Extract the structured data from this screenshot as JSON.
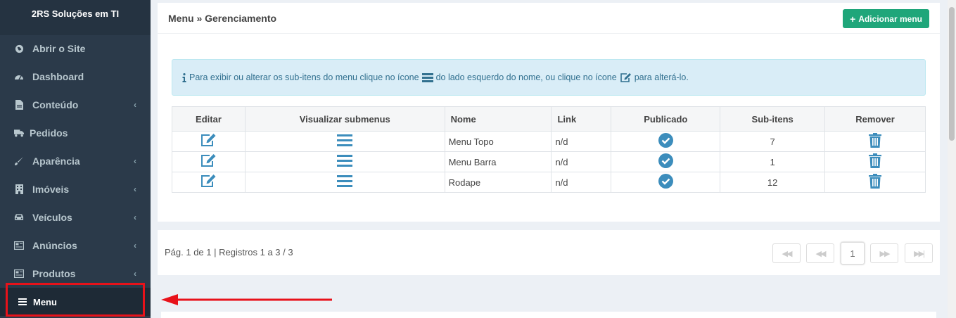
{
  "app": {
    "title": "2RS Soluções em TI"
  },
  "sidebar": {
    "items": [
      {
        "label": "Abrir o Site",
        "icon": "globe-icon",
        "chevron": ""
      },
      {
        "label": "Dashboard",
        "icon": "dashboard-icon",
        "chevron": ""
      },
      {
        "label": "Conteúdo",
        "icon": "file-icon",
        "chevron": "‹"
      },
      {
        "label": "Pedidos",
        "icon": "truck-icon",
        "chevron": ""
      },
      {
        "label": "Aparência",
        "icon": "brush-icon",
        "chevron": "‹"
      },
      {
        "label": "Imóveis",
        "icon": "building-icon",
        "chevron": "‹"
      },
      {
        "label": "Veículos",
        "icon": "car-icon",
        "chevron": "‹"
      },
      {
        "label": "Anúncios",
        "icon": "newspaper-icon",
        "chevron": "‹"
      },
      {
        "label": "Produtos",
        "icon": "newspaper-icon",
        "chevron": "‹"
      },
      {
        "label": "Menu",
        "icon": "bars-icon",
        "chevron": ""
      }
    ]
  },
  "header": {
    "breadcrumb": "Menu » Gerenciamento",
    "add_button": "Adicionar menu",
    "add_icon": "+"
  },
  "info": {
    "part1": "Para exibir ou alterar os sub-itens do menu clique no ícone",
    "part2": "do lado esquerdo do nome, ou clique no ícone",
    "part3": "para alterá-lo."
  },
  "table": {
    "headers": [
      "Editar",
      "Visualizar submenus",
      "Nome",
      "Link",
      "Publicado",
      "Sub-itens",
      "Remover"
    ],
    "rows": [
      {
        "nome": "Menu Topo",
        "link": "n/d",
        "subitens": "7"
      },
      {
        "nome": "Menu Barra",
        "link": "n/d",
        "subitens": "1"
      },
      {
        "nome": "Rodape",
        "link": "n/d",
        "subitens": "12"
      }
    ]
  },
  "pagination": {
    "text": "Pág. 1 de 1 | Registros 1 a 3 / 3",
    "current": "1",
    "first": "◀◀",
    "prev": "◀◀",
    "next": "▶▶",
    "last": "▶▶|"
  },
  "colors": {
    "sidebar": "#2b3a4a",
    "accent_green": "#1fa67a",
    "icon_blue": "#3c8dbc",
    "annotation_red": "#e8121a"
  }
}
